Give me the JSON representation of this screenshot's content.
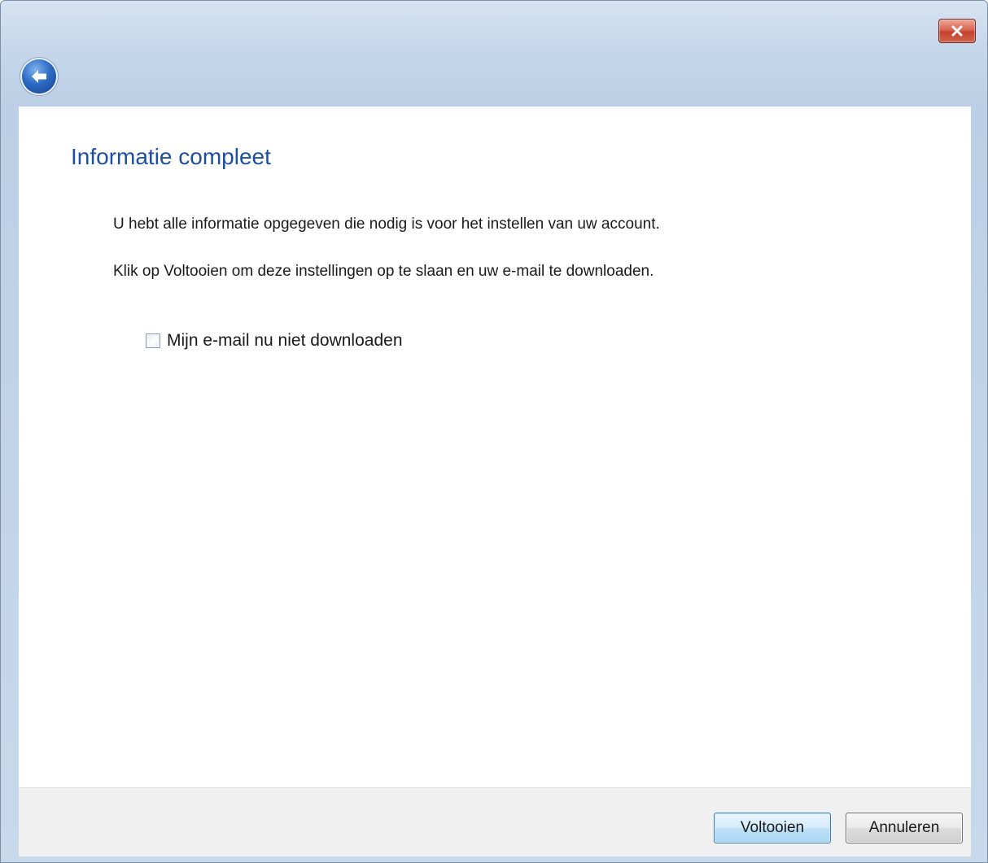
{
  "window": {
    "close_icon": "close-icon",
    "back_icon": "back-arrow-icon"
  },
  "page": {
    "title": "Informatie compleet",
    "paragraph_1": "U hebt alle informatie opgegeven die nodig is voor het instellen van uw account.",
    "paragraph_2": "Klik op Voltooien om deze instellingen op te slaan en uw e-mail te downloaden."
  },
  "options": {
    "no_download_label": "Mijn e-mail nu niet downloaden",
    "no_download_checked": false
  },
  "footer": {
    "finish_label": "Voltooien",
    "cancel_label": "Annuleren"
  },
  "colors": {
    "title": "#1e4f9c",
    "close_button": "#c4432d",
    "back_button": "#2d6cc6"
  }
}
